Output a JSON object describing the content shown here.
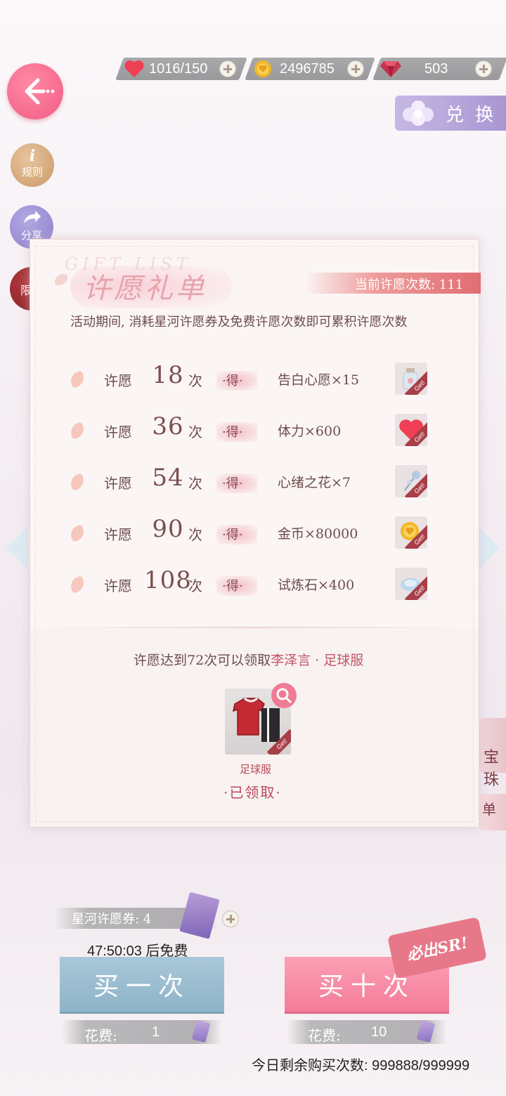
{
  "currencies": {
    "stamina": "1016/150",
    "gold": "2496785",
    "diamond": "503"
  },
  "side": {
    "rule_label": "规则",
    "share_label": "分享",
    "limit_label": "限"
  },
  "exchange_label": "兑 换",
  "panel": {
    "ghost_title": "GIFT  LIST",
    "title": "许愿礼单",
    "wish_count": "当前许愿次数: 111",
    "description": "活动期间, 消耗星河许愿券及免费许愿次数即可累积许愿次数",
    "rows": [
      {
        "prefix": "许愿",
        "count": "18",
        "unit": "次",
        "get": "·得·",
        "reward": "告白心愿×15"
      },
      {
        "prefix": "许愿",
        "count": "36",
        "unit": "次",
        "get": "·得·",
        "reward": "体力×600"
      },
      {
        "prefix": "许愿",
        "count": "54",
        "unit": "次",
        "get": "·得·",
        "reward": "心绪之花×7"
      },
      {
        "prefix": "许愿",
        "count": "90",
        "unit": "次",
        "get": "·得·",
        "reward": "金币×80000"
      },
      {
        "prefix": "许愿",
        "count": "108",
        "unit": "次",
        "get": "·得·",
        "reward": "试炼石×400"
      }
    ],
    "get_tag": "Get!",
    "claim_prefix": "许愿达到72次可以领取",
    "claim_highlight": "李泽言 · 足球服",
    "outfit_name": "足球服",
    "claimed": "·已领取·"
  },
  "right_peek": {
    "card1": "宝珠",
    "card2": "单"
  },
  "bottom": {
    "ticket_label": "星河许愿券: 4",
    "free_timer": "47:50:03 后免费",
    "buy_one": "买一次",
    "buy_ten": "买十次",
    "sr_badge": "必出SR!",
    "cost_label": "花费:",
    "cost_one": "1",
    "cost_ten": "10",
    "daily_remaining": "今日剩余购买次数: 999888/999999"
  }
}
